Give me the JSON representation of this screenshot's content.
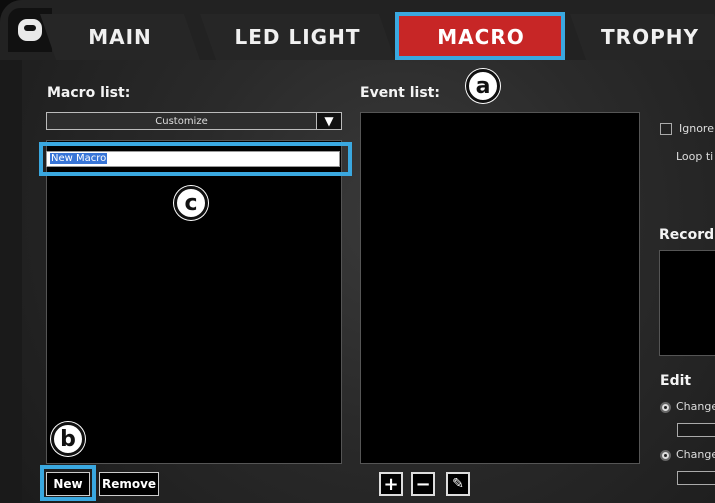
{
  "tabs": {
    "main": "MAIN",
    "led_light": "LED LIGHT",
    "macro": "MACRO",
    "trophy": "TROPHY"
  },
  "colors": {
    "active_tab": "#c72626",
    "highlight": "#3aa8e0"
  },
  "macro_list": {
    "label": "Macro list:",
    "dropdown_value": "Customize",
    "new_macro_value": "New Macro"
  },
  "event_list": {
    "label": "Event list:"
  },
  "buttons": {
    "new": "New",
    "remove": "Remove",
    "add_icon": "+",
    "remove_icon": "−",
    "edit_icon": "✎"
  },
  "right_panel": {
    "ignore_label": "Ignore",
    "loop_label": "Loop ti",
    "record_label": "Record",
    "edit_label": "Edit",
    "change_1": "Change",
    "change_2": "Change"
  },
  "callouts": {
    "a": "a",
    "b": "b",
    "c": "c"
  }
}
